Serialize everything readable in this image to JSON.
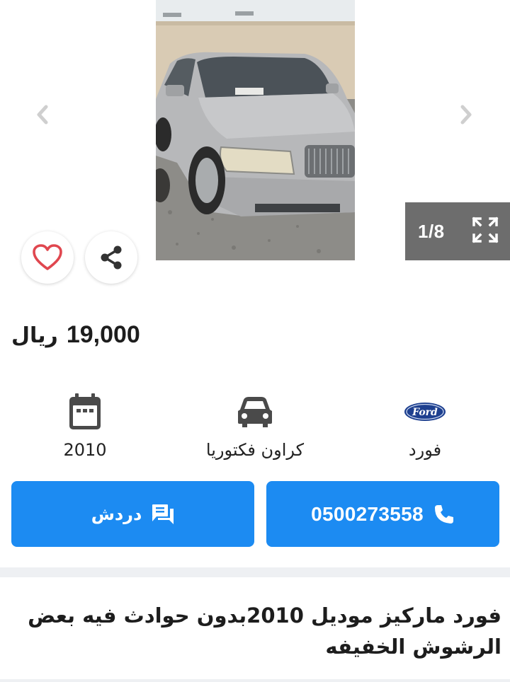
{
  "gallery": {
    "counter": "1/8",
    "prev_icon": "chevron-left-icon",
    "next_icon": "chevron-right-icon",
    "expand_icon": "fullscreen-icon",
    "favorite_icon": "heart-icon",
    "share_icon": "share-icon"
  },
  "listing": {
    "price": "19,000",
    "currency": "ريال",
    "specs": {
      "year": "2010",
      "model": "كراون فكتوريا",
      "brand": "فورد",
      "brand_logo_text": "Ford"
    },
    "actions": {
      "chat_label": "دردش",
      "phone": "0500273558"
    },
    "description": "فورد ماركيز موديل 2010بدون حوادث فيه بعض الرشوش الخفيفه"
  },
  "colors": {
    "primary": "#1c8bf2",
    "favorite": "#e0474f",
    "counter_bg": "#6d6d6d",
    "divider": "#eef0f3"
  }
}
